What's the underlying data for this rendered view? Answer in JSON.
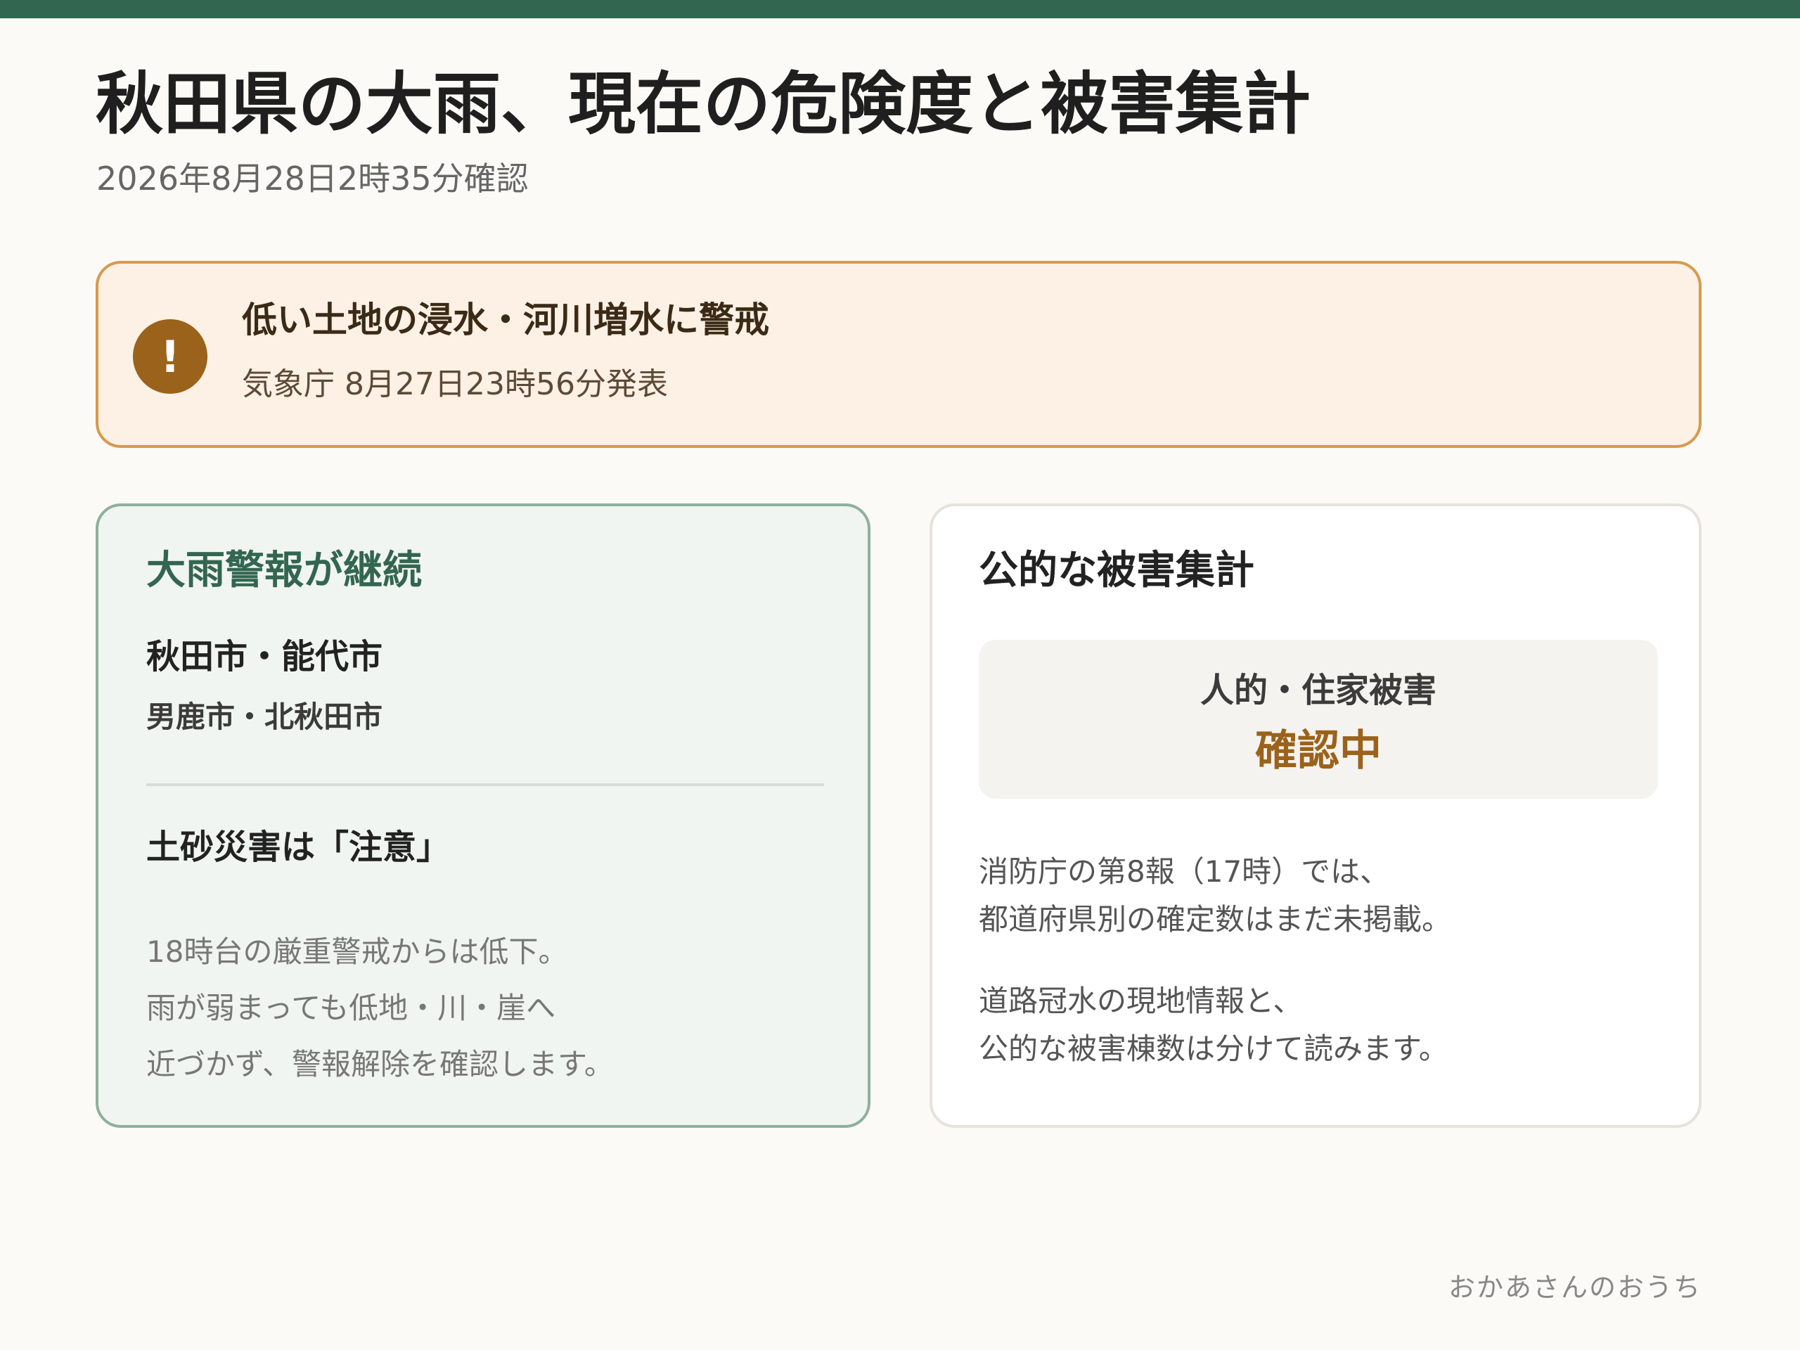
{
  "header": {
    "title": "秋田県の大雨、現在の危険度と被害集計",
    "checked_at": "2026年8月28日2時35分確認"
  },
  "alert": {
    "icon": "exclamation-icon",
    "icon_glyph": "!",
    "title": "低い土地の浸水・河川増水に警戒",
    "source": "気象庁 8月27日23時56分発表"
  },
  "warning_card": {
    "title": "大雨警報が継続",
    "cities_primary": "秋田市・能代市",
    "cities_secondary": "男鹿市・北秋田市",
    "landslide_title": "土砂災害は「注意」",
    "landslide_note": [
      "18時台の厳重警戒からは低下。",
      "雨が弱まっても低地・川・崖へ",
      "近づかず、警報解除を確認します。"
    ]
  },
  "damage_card": {
    "title": "公的な被害集計",
    "status_label": "人的・住家被害",
    "status_value": "確認中",
    "report_note": [
      "消防庁の第8報（17時）では、",
      "都道府県別の確定数はまだ未掲載。"
    ],
    "reading_note": [
      "道路冠水の現地情報と、",
      "公的な被害棟数は分けて読みます。"
    ]
  },
  "footer": {
    "brand": "おかあさんのおうち"
  },
  "colors": {
    "accent_green": "#336650",
    "alert_brown": "#9a621b",
    "alert_border": "#d69a4e",
    "alert_bg": "#fdf0e4"
  }
}
